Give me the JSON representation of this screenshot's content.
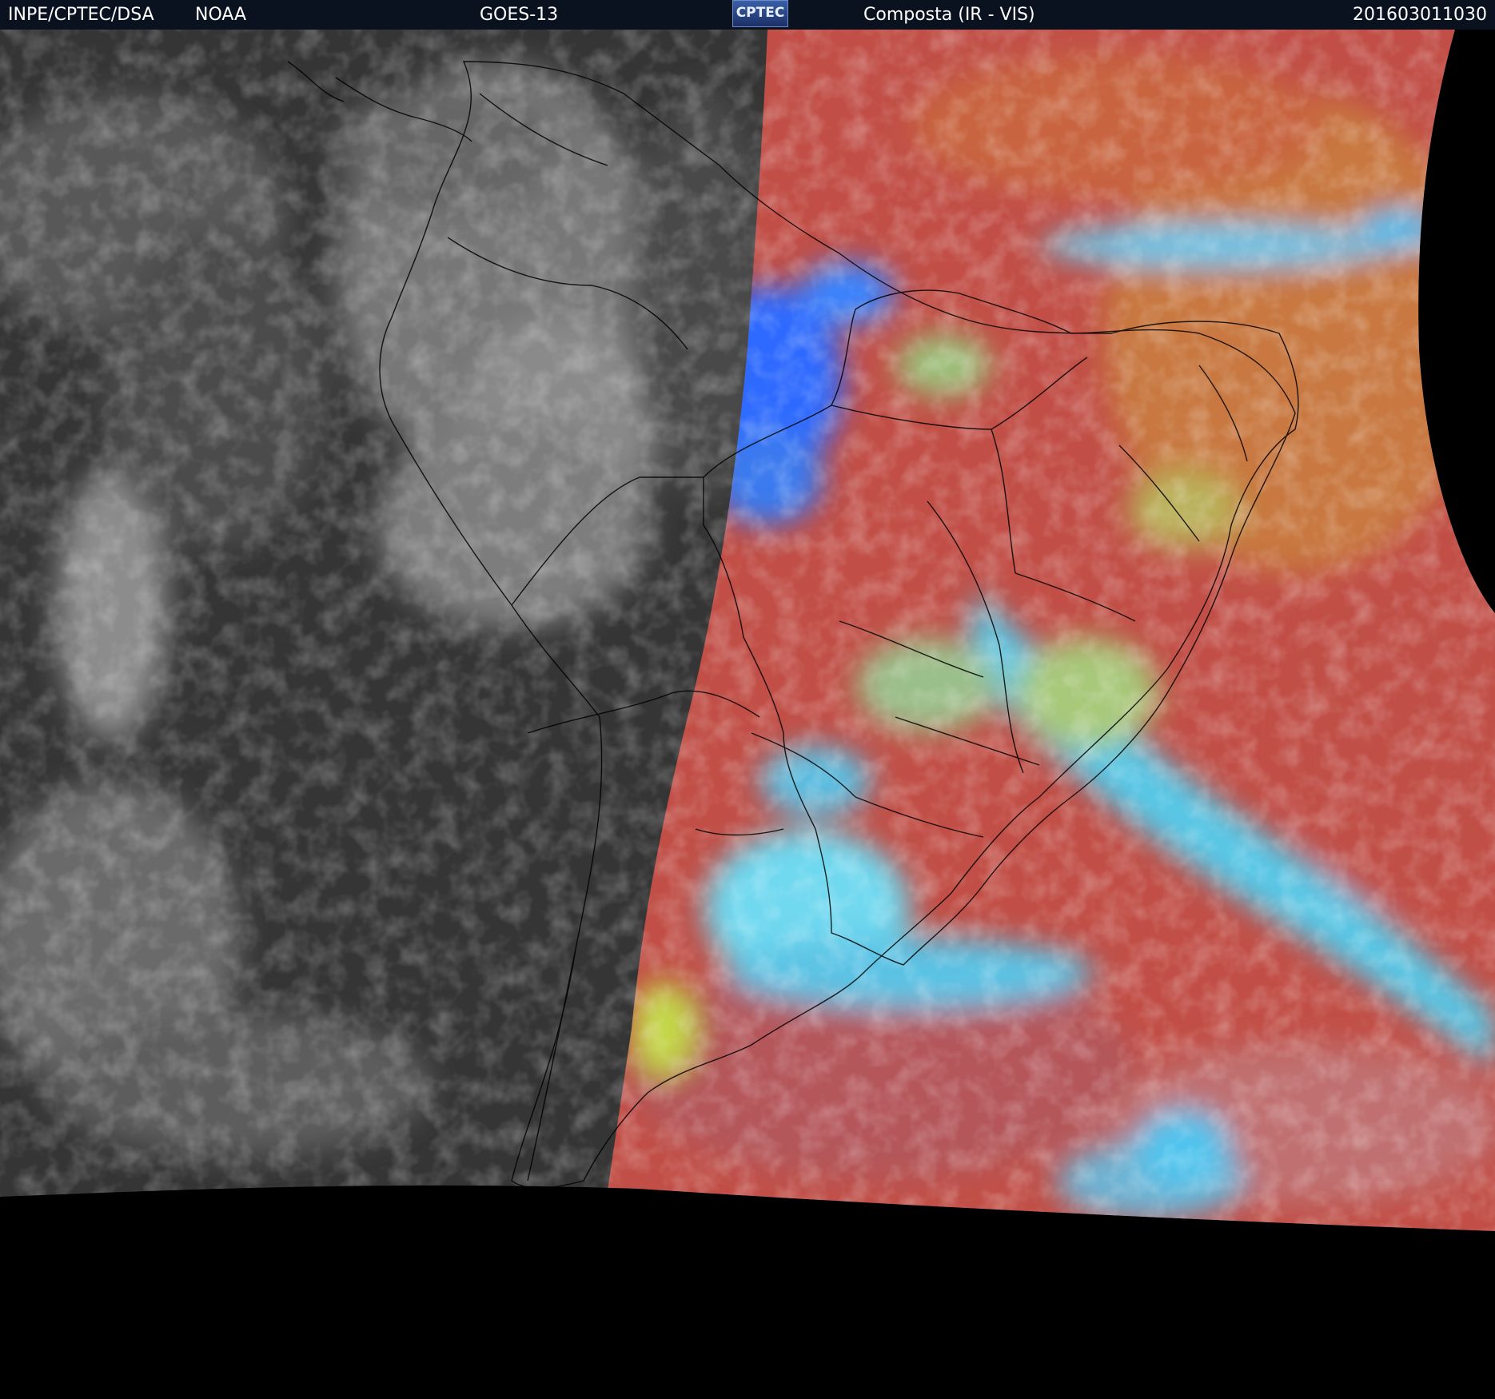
{
  "header": {
    "agency": "INPE/CPTEC/DSA",
    "source": "NOAA",
    "satellite": "GOES-13",
    "logo_text": "CPTEC",
    "product": "Composta (IR - VIS)",
    "timestamp": "201603011030"
  },
  "colors": {
    "header_bg": "#0a1220",
    "ir_ocean": "#3a3a3a",
    "vis_land": "#b84a48",
    "vis_ocean": "#c85a45",
    "cloud_cyan": "#57c8e8",
    "cloud_blue": "#2f6bff",
    "cloud_yellow": "#c7d84a",
    "borders": "#000000"
  }
}
